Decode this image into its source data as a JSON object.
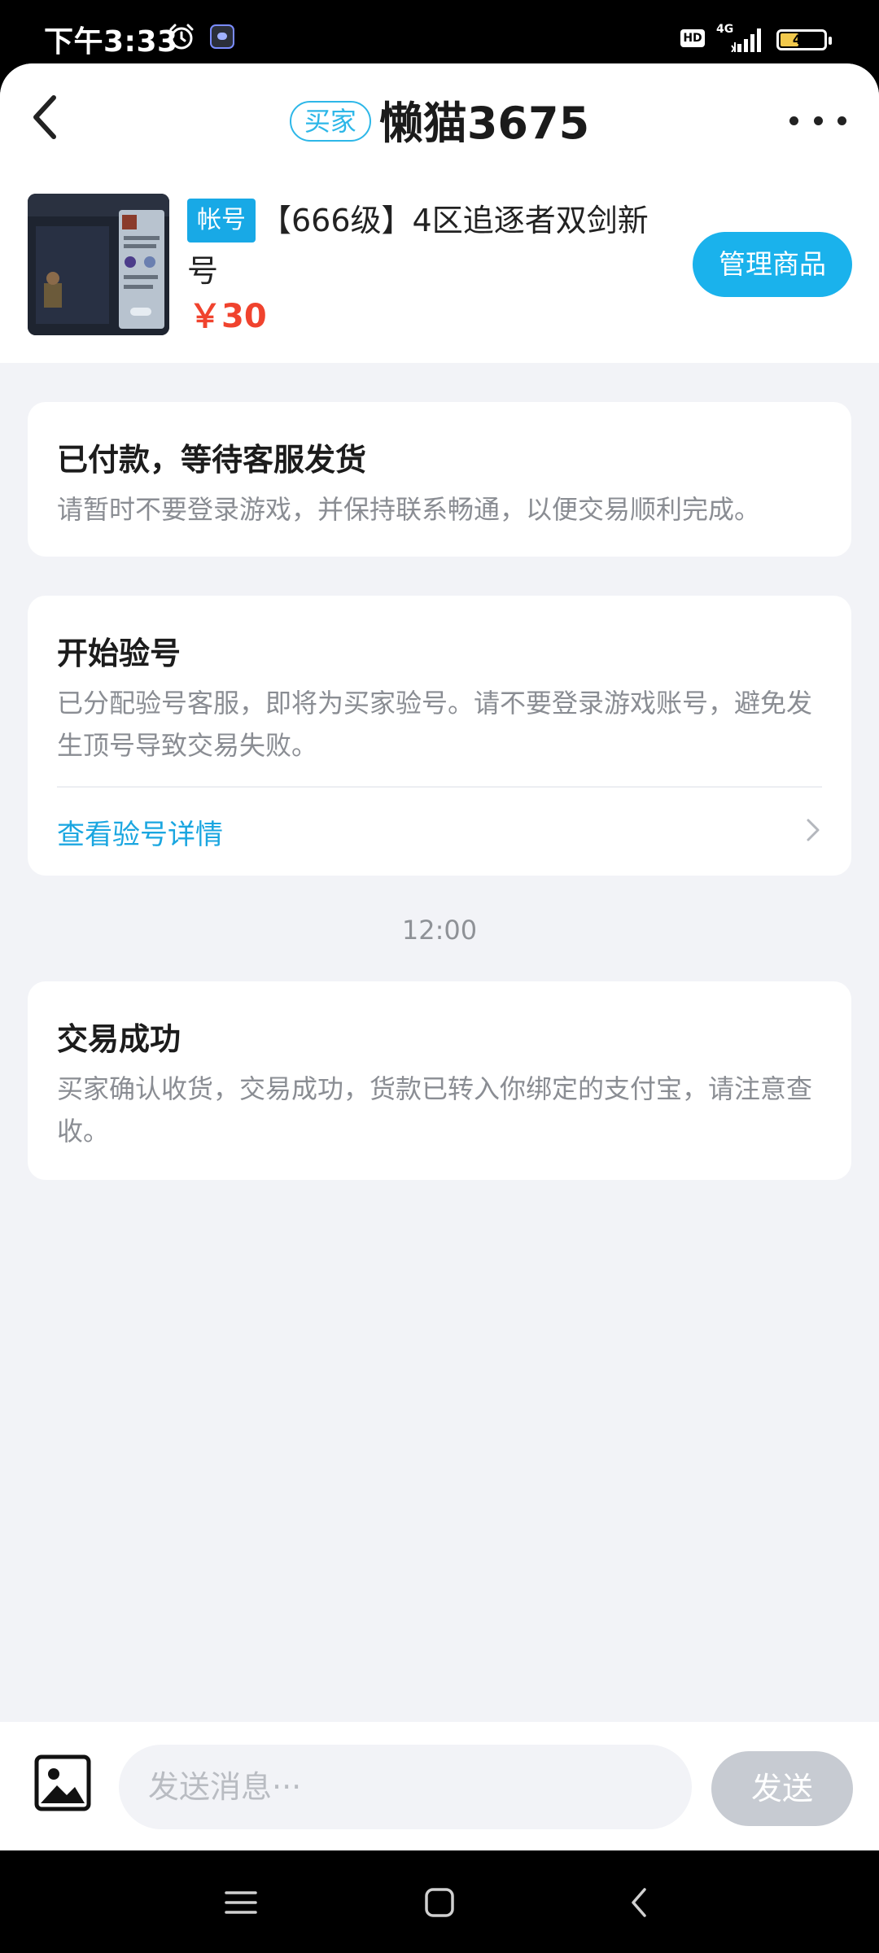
{
  "status_bar": {
    "time": "下午3:33",
    "hd_label": "HD",
    "network": "4G",
    "battery": "43",
    "battery_level": 0.43,
    "icons": [
      "alarm-icon",
      "app-notification-icon",
      "signal-icon",
      "battery-icon"
    ]
  },
  "header": {
    "role_badge": "买家",
    "title": "懒猫3675",
    "icons": [
      "back-arrow-icon",
      "more-dots-icon"
    ]
  },
  "product": {
    "tag": "帐号",
    "title": "【666级】4区追逐者双剑新号",
    "price": "￥30",
    "manage_label": "管理商品"
  },
  "cards": [
    {
      "title": "已付款，等待客服发货",
      "desc": "请暂时不要登录游戏，并保持联系畅通，以便交易顺利完成。"
    },
    {
      "title": "开始验号",
      "desc": "已分配验号客服，即将为买家验号。请不要登录游戏账号，避免发生顶号导致交易失败。",
      "link": "查看验号详情"
    },
    {
      "title": "交易成功",
      "desc": "买家确认收货，交易成功，货款已转入你绑定的支付宝，请注意查收。"
    }
  ],
  "timestamp": "12:00",
  "input_bar": {
    "placeholder": "发送消息···",
    "send_label": "发送"
  },
  "colors": {
    "accent": "#1ab2ec",
    "price": "#f0432e",
    "background": "#f2f3f7",
    "send_disabled": "#c7cbd2"
  }
}
